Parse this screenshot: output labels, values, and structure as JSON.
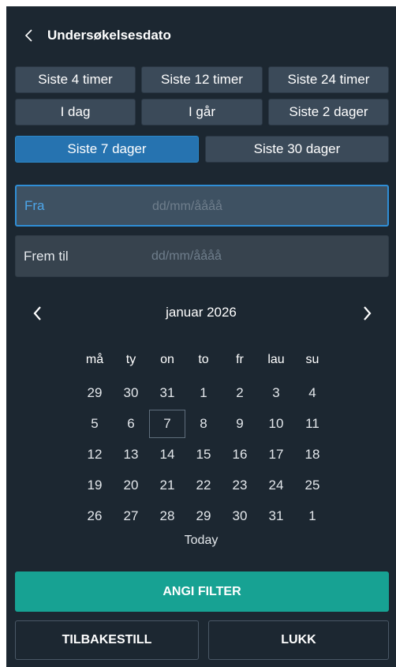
{
  "header": {
    "title": "Undersøkelsesdato",
    "back_icon": "chevron-left-icon"
  },
  "quick_ranges": [
    {
      "label": "Siste 4 timer",
      "active": false
    },
    {
      "label": "Siste 12 timer",
      "active": false
    },
    {
      "label": "Siste 24 timer",
      "active": false
    },
    {
      "label": "I dag",
      "active": false
    },
    {
      "label": "I går",
      "active": false
    },
    {
      "label": "Siste 2 dager",
      "active": false
    },
    {
      "label": "Siste 7 dager",
      "active": true
    },
    {
      "label": "Siste 30 dager",
      "active": false
    }
  ],
  "from_field": {
    "label": "Fra",
    "placeholder": "dd/mm/åååå",
    "value": ""
  },
  "to_field": {
    "label": "Frem til",
    "placeholder": "dd/mm/åååå",
    "value": ""
  },
  "calendar": {
    "month_label": "januar 2026",
    "prev_icon": "chevron-left-icon",
    "next_icon": "chevron-right-icon",
    "weekdays": [
      "må",
      "ty",
      "on",
      "to",
      "fr",
      "lau",
      "su"
    ],
    "weeks": [
      [
        "29",
        "30",
        "31",
        "1",
        "2",
        "3",
        "4"
      ],
      [
        "5",
        "6",
        "7",
        "8",
        "9",
        "10",
        "11"
      ],
      [
        "12",
        "13",
        "14",
        "15",
        "16",
        "17",
        "18"
      ],
      [
        "19",
        "20",
        "21",
        "22",
        "23",
        "24",
        "25"
      ],
      [
        "26",
        "27",
        "28",
        "29",
        "30",
        "31",
        "1"
      ]
    ],
    "today_week": 1,
    "today_day": 2,
    "today_label": "Today"
  },
  "actions": {
    "apply_label": "ANGI FILTER",
    "reset_label": "TILBAKESTILL",
    "close_label": "LUKK"
  },
  "colors": {
    "panel_bg": "#1c2731",
    "button_bg": "#3b4a59",
    "active_button_bg": "#2673b0",
    "apply_bg": "#17a293",
    "focus_border": "#2f8ed6"
  }
}
